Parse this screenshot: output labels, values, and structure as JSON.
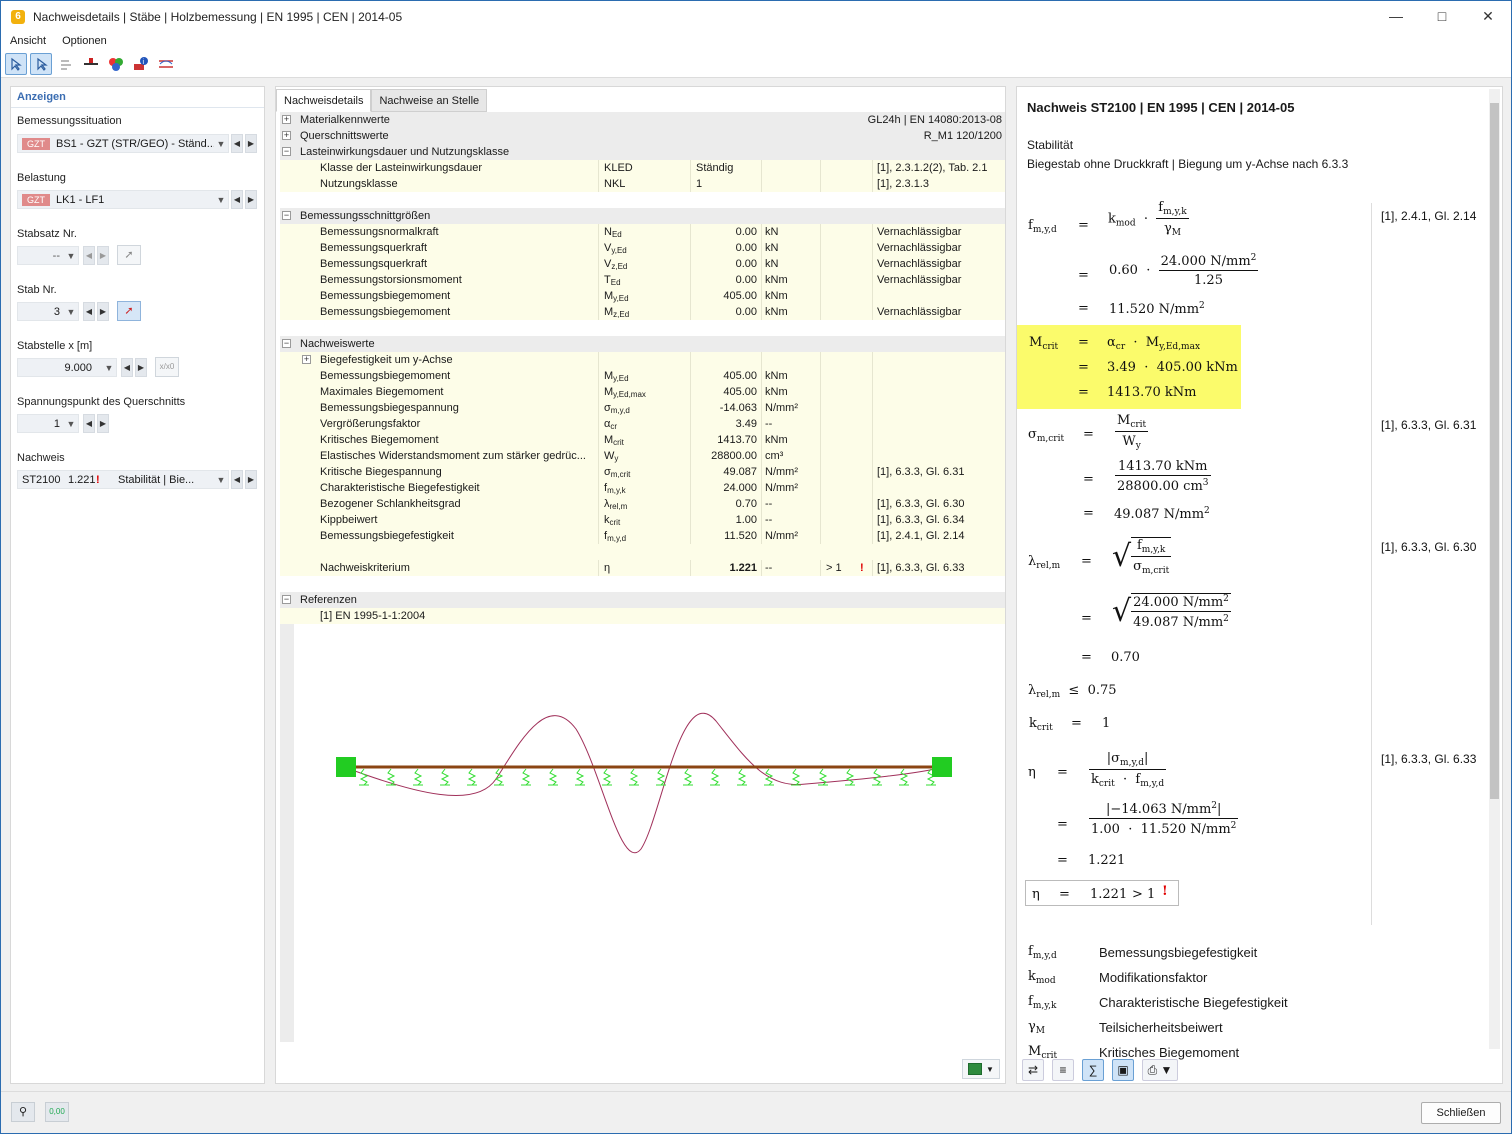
{
  "window": {
    "title": "Nachweisdetails | Stäbe | Holzbemessung | EN 1995 | CEN | 2014-05"
  },
  "menu": [
    "Ansicht",
    "Optionen"
  ],
  "left": {
    "header": "Anzeigen",
    "situation_label": "Bemessungssituation",
    "situation_tag": "GZT",
    "situation_value": "BS1 - GZT (STR/GEO) - Ständ...",
    "load_label": "Belastung",
    "load_tag": "GZT",
    "load_value": "LK1 - LF1",
    "stabsatz_label": "Stabsatz Nr.",
    "stabsatz_value": "--",
    "stab_label": "Stab Nr.",
    "stab_value": "3",
    "stelle_label": "Stabstelle x [m]",
    "stelle_value": "9.000",
    "stelle_btn": "x/x0",
    "punkt_label": "Spannungspunkt des Querschnitts",
    "punkt_value": "1",
    "nachweis_label": "Nachweis",
    "nachweis_id": "ST2100",
    "nachweis_ratio": "1.221",
    "nachweis_type": "Stabilität | Bie..."
  },
  "tabs": [
    "Nachweisdetails",
    "Nachweise an Stelle"
  ],
  "grid": [
    {
      "t": "grp",
      "pm": "+",
      "name": "Materialkennwerte",
      "ref": "GL24h | EN 14080:2013-08",
      "refAlign": "right"
    },
    {
      "t": "grp",
      "pm": "+",
      "name": "Querschnittswerte",
      "ref": "R_M1 120/1200",
      "refAlign": "right"
    },
    {
      "t": "grp",
      "pm": "−",
      "name": "Lasteinwirkungsdauer und Nutzungsklasse"
    },
    {
      "t": "sub",
      "name": "Klasse der Lasteinwirkungsdauer",
      "sym": "KLED",
      "val": "Ständig",
      "valAlign": "left",
      "ref": "[1], 2.3.1.2(2), Tab. 2.1"
    },
    {
      "t": "sub",
      "name": "Nutzungsklasse",
      "sym": "NKL",
      "val": "1",
      "valAlign": "left",
      "ref": "[1], 2.3.1.3"
    },
    {
      "t": "emp"
    },
    {
      "t": "grp",
      "pm": "−",
      "name": "Bemessungsschnittgrößen"
    },
    {
      "t": "sub",
      "name": "Bemessungsnormalkraft",
      "sym": "N",
      "symsub": "Ed",
      "val": "0.00",
      "unit": "kN",
      "ref": "Vernachlässigbar"
    },
    {
      "t": "sub",
      "name": "Bemessungsquerkraft",
      "sym": "V",
      "symsub": "y,Ed",
      "val": "0.00",
      "unit": "kN",
      "ref": "Vernachlässigbar"
    },
    {
      "t": "sub",
      "name": "Bemessungsquerkraft",
      "sym": "V",
      "symsub": "z,Ed",
      "val": "0.00",
      "unit": "kN",
      "ref": "Vernachlässigbar"
    },
    {
      "t": "sub",
      "name": "Bemessungstorsionsmoment",
      "sym": "T",
      "symsub": "Ed",
      "val": "0.00",
      "unit": "kNm",
      "ref": "Vernachlässigbar"
    },
    {
      "t": "sub",
      "name": "Bemessungsbiegemoment",
      "sym": "M",
      "symsub": "y,Ed",
      "val": "405.00",
      "unit": "kNm",
      "ref": ""
    },
    {
      "t": "sub",
      "name": "Bemessungsbiegemoment",
      "sym": "M",
      "symsub": "z,Ed",
      "val": "0.00",
      "unit": "kNm",
      "ref": "Vernachlässigbar"
    },
    {
      "t": "emp"
    },
    {
      "t": "grp",
      "pm": "−",
      "name": "Nachweiswerte"
    },
    {
      "t": "sub",
      "pm": "+",
      "name": "Biegefestigkeit um y-Achse",
      "indent": true
    },
    {
      "t": "sub",
      "name": "Bemessungsbiegemoment",
      "sym": "M",
      "symsub": "y,Ed",
      "val": "405.00",
      "unit": "kNm",
      "ref": ""
    },
    {
      "t": "sub",
      "name": "Maximales Biegemoment",
      "sym": "M",
      "symsub": "y,Ed,max",
      "val": "405.00",
      "unit": "kNm",
      "ref": ""
    },
    {
      "t": "sub",
      "name": "Bemessungsbiegespannung",
      "sym": "σ",
      "symsub": "m,y,d",
      "val": "-14.063",
      "unit": "N/mm²",
      "ref": ""
    },
    {
      "t": "sub",
      "name": "Vergrößerungsfaktor",
      "sym": "α",
      "symsub": "cr",
      "val": "3.49",
      "unit": "--",
      "ref": ""
    },
    {
      "t": "sub",
      "name": "Kritisches Biegemoment",
      "sym": "M",
      "symsub": "crit",
      "val": "1413.70",
      "unit": "kNm",
      "ref": ""
    },
    {
      "t": "sub",
      "name": "Elastisches Widerstandsmoment zum stärker gedrüc...",
      "sym": "W",
      "symsub": "y",
      "val": "28800.00",
      "unit": "cm³",
      "ref": ""
    },
    {
      "t": "sub",
      "name": "Kritische Biegespannung",
      "sym": "σ",
      "symsub": "m,crit",
      "val": "49.087",
      "unit": "N/mm²",
      "ref": "[1], 6.3.3, Gl. 6.31"
    },
    {
      "t": "sub",
      "name": "Charakteristische Biegefestigkeit",
      "sym": "f",
      "symsub": "m,y,k",
      "val": "24.000",
      "unit": "N/mm²",
      "ref": ""
    },
    {
      "t": "sub",
      "name": "Bezogener Schlankheitsgrad",
      "sym": "λ",
      "symsub": "rel,m",
      "val": "0.70",
      "unit": "--",
      "ref": "[1], 6.3.3, Gl. 6.30"
    },
    {
      "t": "sub",
      "name": "Kippbeiwert",
      "sym": "k",
      "symsub": "crit",
      "val": "1.00",
      "unit": "--",
      "ref": "[1], 6.3.3, Gl. 6.34"
    },
    {
      "t": "sub",
      "name": "Bemessungsbiegefestigkeit",
      "sym": "f",
      "symsub": "m,y,d",
      "val": "11.520",
      "unit": "N/mm²",
      "ref": "[1], 2.4.1, Gl. 2.14"
    },
    {
      "t": "sub",
      "name": ""
    },
    {
      "t": "sub",
      "name": "Nachweiskriterium",
      "sym": "η",
      "val": "1.221",
      "bold": true,
      "unit": "--",
      "cmp": "> 1",
      "warn": true,
      "ref": "[1], 6.3.3, Gl. 6.33"
    },
    {
      "t": "emp"
    },
    {
      "t": "grp",
      "pm": "−",
      "name": "Referenzen"
    },
    {
      "t": "sub",
      "name": "[1]  EN 1995-1-1:2004",
      "plain": true
    }
  ],
  "right": {
    "title": "Nachweis ST2100 | EN 1995 | CEN | 2014-05",
    "line1": "Stabilität",
    "line2": "Biegestab ohne Druckkraft | Biegung um y-Achse nach 6.3.3",
    "ref1": "[1], 2.4.1, Gl. 2.14",
    "ref2": "[1], 6.3.3, Gl. 6.31",
    "ref3": "[1], 6.3.3, Gl. 6.30",
    "ref4": "[1], 6.3.3, Gl. 6.33",
    "kmod": "0.60",
    "fmyk": "24.000 N/mm",
    "gm": "1.25",
    "fmyd": "11.520 N/mm",
    "acr": "3.49",
    "myed": "405.00 kNm",
    "mcrit": "1413.70 kNm",
    "wy": "28800.00 cm",
    "smcrit": "49.087 N/mm",
    "lam": "0.70",
    "lamlim": "0.75",
    "kcrit": "1",
    "smyd": "−14.063 N/mm",
    "kc": "1.00",
    "eta": "1.221",
    "crit": "> 1",
    "legend": [
      [
        "f",
        "m,y,d",
        "Bemessungsbiegefestigkeit"
      ],
      [
        "k",
        "mod",
        "Modifikationsfaktor"
      ],
      [
        "f",
        "m,y,k",
        "Charakteristische Biegefestigkeit"
      ],
      [
        "γ",
        "M",
        "Teilsicherheitsbeiwert"
      ],
      [
        "M",
        "crit",
        "Kritisches Biegemoment"
      ]
    ]
  },
  "close_label": "Schließen",
  "colors": {
    "accent": "#3b6db2",
    "highlight": "#fbfb6b",
    "beam": "#8b4513",
    "support": "#22cc22",
    "warn": "#e00000"
  }
}
